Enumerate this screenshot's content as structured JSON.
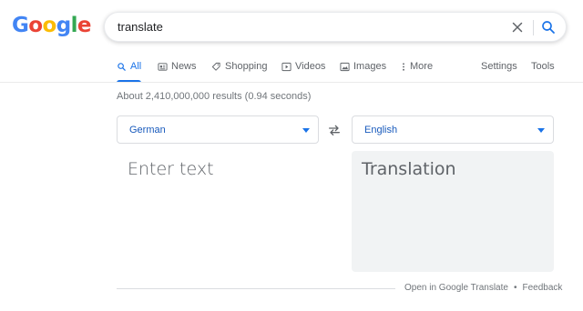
{
  "logo": {
    "letters": [
      "G",
      "o",
      "o",
      "g",
      "l",
      "e"
    ],
    "colors": [
      "#4285f4",
      "#ea4335",
      "#fbbc05",
      "#4285f4",
      "#34a853",
      "#ea4335"
    ]
  },
  "search": {
    "query": "translate"
  },
  "tabs": [
    {
      "label": "All",
      "icon": "search-icon",
      "active": true
    },
    {
      "label": "News",
      "icon": "news-icon",
      "active": false
    },
    {
      "label": "Shopping",
      "icon": "tag-icon",
      "active": false
    },
    {
      "label": "Videos",
      "icon": "play-icon",
      "active": false
    },
    {
      "label": "Images",
      "icon": "image-icon",
      "active": false
    },
    {
      "label": "More",
      "icon": "more-vert-icon",
      "active": false
    }
  ],
  "right_links": {
    "settings": "Settings",
    "tools": "Tools"
  },
  "stats": "About 2,410,000,000 results (0.94 seconds)",
  "translate": {
    "source_language": "German",
    "target_language": "English",
    "input_placeholder": "Enter text",
    "output_placeholder": "Translation"
  },
  "footer": {
    "open_link": "Open in Google Translate",
    "separator": "•",
    "feedback": "Feedback"
  },
  "colors": {
    "accent": "#1a73e8",
    "output_bg": "#f1f3f4",
    "muted_text": "#5f6368"
  }
}
